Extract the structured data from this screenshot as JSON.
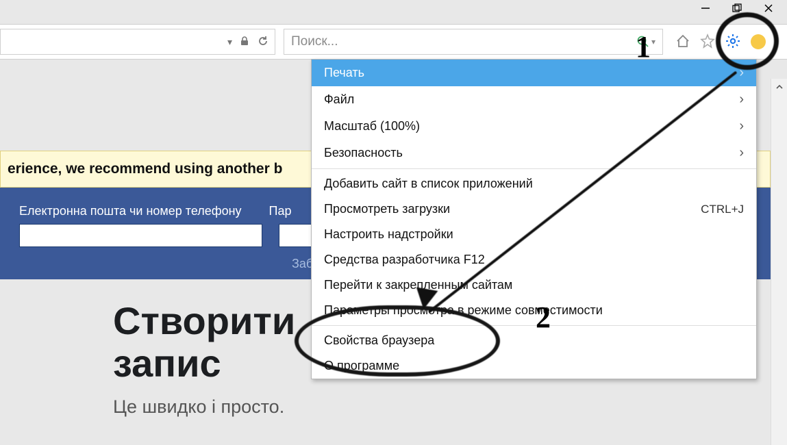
{
  "window": {
    "minimize_icon": "minimize",
    "maximize_icon": "maximize",
    "close_icon": "close"
  },
  "toolbar": {
    "search_placeholder": "Поиск...",
    "dropdown_icon": "dropdown",
    "lock_icon": "lock",
    "refresh_icon": "refresh",
    "magnify_icon": "search",
    "home_icon": "home",
    "star_icon": "favorites",
    "gear_icon": "settings",
    "smiley_icon": "emoji"
  },
  "menu": {
    "items": [
      {
        "label": "Печать",
        "has_submenu": true,
        "hover": true
      },
      {
        "label": "Файл",
        "has_submenu": true
      },
      {
        "label": "Масштаб (100%)",
        "has_submenu": true
      },
      {
        "label": "Безопасность",
        "has_submenu": true
      }
    ],
    "items2": [
      {
        "label": "Добавить сайт в список приложений"
      },
      {
        "label": "Просмотреть загрузки",
        "shortcut": "CTRL+J"
      },
      {
        "label": "Настроить надстройки"
      },
      {
        "label": "Средства разработчика F12"
      },
      {
        "label": "Перейти к закрепленным сайтам"
      },
      {
        "label": "Параметры просмотра в режиме совместимости"
      }
    ],
    "items3": [
      {
        "label": "Свойства браузера"
      },
      {
        "label": "О программе"
      }
    ]
  },
  "page": {
    "banner_text": "erience, we recommend using another b",
    "login": {
      "email_label": "Електронна пошта чи номер телефону",
      "password_label": "Пар",
      "forgot_text": "Забу"
    },
    "heading_line1": "Створити",
    "heading_line2": "запис",
    "subheading": "Це швидко і просто."
  },
  "annotations": {
    "num1": "1",
    "num2": "2"
  }
}
